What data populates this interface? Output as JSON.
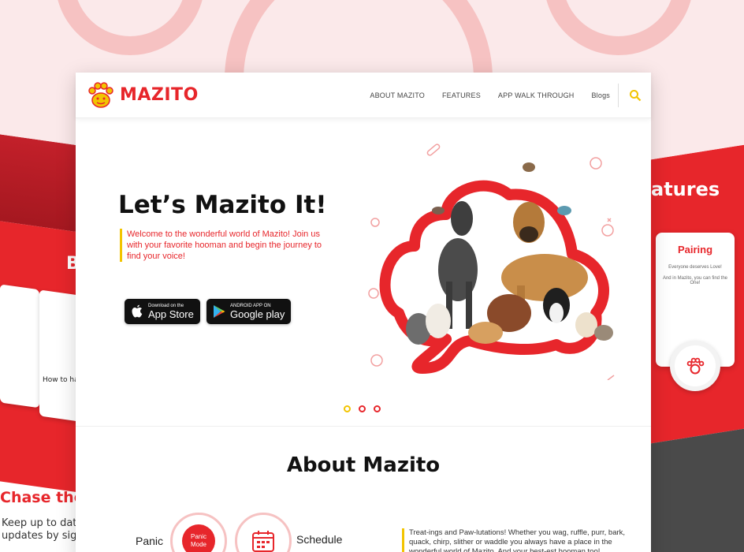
{
  "app": {
    "name": "MAZITO"
  },
  "nav": {
    "items": [
      {
        "label": "ABOUT MAZITO"
      },
      {
        "label": "FEATURES"
      },
      {
        "label": "APP WALK THROUGH"
      },
      {
        "label": "Blogs"
      }
    ],
    "search_icon": "search-icon"
  },
  "hero": {
    "title": "Let’s Mazito It!",
    "intro": "Welcome to the wonderful world of Mazito! Join us with your favorite hooman and begin the journey to find your voice!",
    "app_store": {
      "small": "Download on the",
      "big": "App Store"
    },
    "google_play": {
      "small": "ANDROID APP ON",
      "big": "Google play"
    },
    "slides": [
      {
        "active": true
      },
      {
        "active": false
      },
      {
        "active": false
      }
    ]
  },
  "about": {
    "title": "About Mazito",
    "features": [
      {
        "label": "Panic",
        "badge": "Panic Mode"
      },
      {
        "label": "Schedule"
      }
    ],
    "text": "Treat-ings and Paw-lutations! Whether you wag, ruffle, purr, bark, quack, chirp, slither or waddle you always have a place in the wonderful world of Mazito. And your best-est hooman too!"
  },
  "side_left": {
    "heading_fragment": "B",
    "card_title": "How to han",
    "bottom_heading": "Chase the",
    "bottom_text_1": "Keep up to dat",
    "bottom_text_2": "updates by sig"
  },
  "side_right": {
    "heading_fragment": "atures",
    "card_title": "Pairing",
    "card_line_1": "Everyone deserves Love!",
    "card_line_2": "And in Mazito, you can find the One!"
  },
  "colors": {
    "brand_red": "#e7262b",
    "accent_yellow": "#f2c400",
    "pink_bg": "#fbe9ea"
  }
}
